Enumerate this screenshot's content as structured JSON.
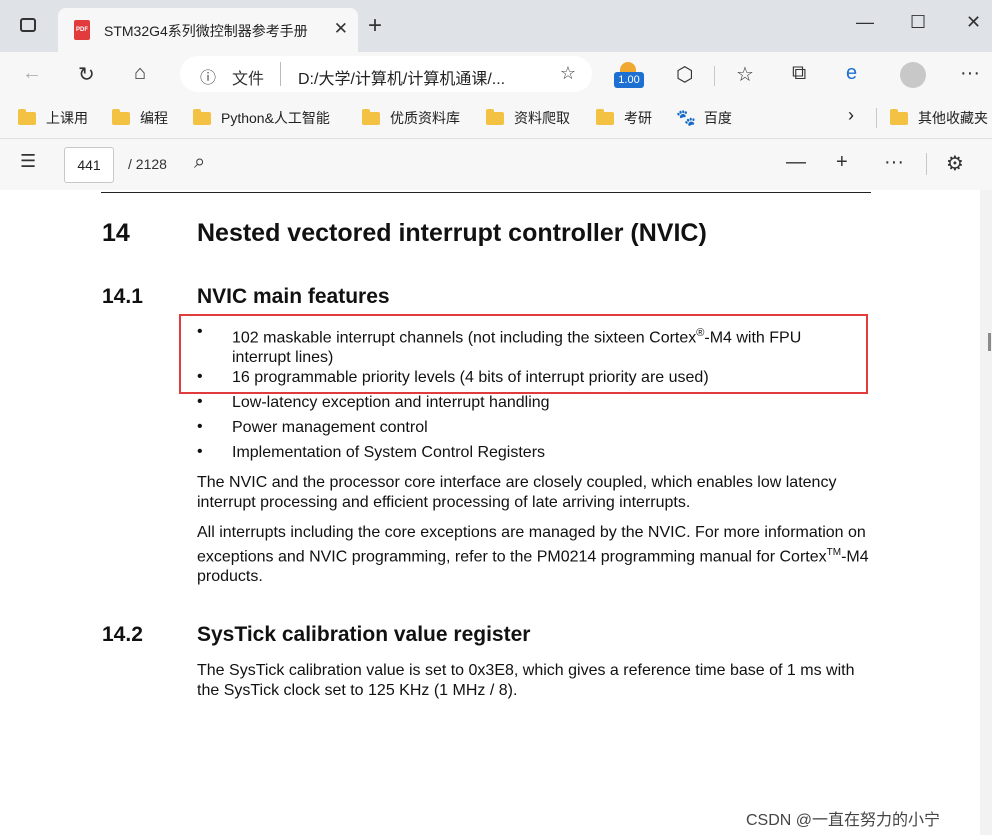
{
  "browser": {
    "tab": {
      "icon_label": "PDF",
      "title": "STM32G4系列微控制器参考手册",
      "close": "✕"
    },
    "new_tab": "+",
    "window_controls": {
      "minimize": "—",
      "maximize": "☐",
      "close": "✕"
    },
    "address": {
      "protocol_label": "文件",
      "path": "D:/大学/计算机/计算机通课/..."
    },
    "extension_badge": "1.00",
    "bookmarks": [
      {
        "label": "上课用",
        "icon": "folder-icon"
      },
      {
        "label": "编程",
        "icon": "folder-icon"
      },
      {
        "label": "Python&人工智能",
        "icon": "folder-icon"
      },
      {
        "label": "优质资料库",
        "icon": "folder-icon"
      },
      {
        "label": "资料爬取",
        "icon": "folder-icon"
      },
      {
        "label": "考研",
        "icon": "folder-icon"
      },
      {
        "label": "百度",
        "icon": "baidu-paw-icon"
      }
    ],
    "other_bookmarks": "其他收藏夹"
  },
  "pdf_toolbar": {
    "page_current": "441",
    "page_total": "/ 2128"
  },
  "document": {
    "chapter_num": "14",
    "chapter_title": "Nested vectored interrupt controller (NVIC)",
    "section1_num": "14.1",
    "section1_title": "NVIC main features",
    "features": [
      {
        "pre": "102 maskable interrupt channels (not including the sixteen Cortex",
        "sup": "®",
        "post": "-M4 with FPU interrupt lines)"
      },
      {
        "text": "16 programmable priority levels (4 bits of interrupt priority are used)"
      },
      {
        "text": "Low-latency exception and interrupt handling"
      },
      {
        "text": "Power management control"
      },
      {
        "text": "Implementation of System Control Registers"
      }
    ],
    "para1": "The NVIC and the processor core interface are closely coupled, which enables low latency interrupt processing and efficient processing of late arriving interrupts.",
    "para2_pre": "All interrupts including the core exceptions are managed by the NVIC. For more information on exceptions and NVIC programming, refer to the PM0214 programming manual for Cortex",
    "para2_sup": "TM",
    "para2_post": "-M4 products.",
    "section2_num": "14.2",
    "section2_title": "SysTick calibration value register",
    "para3": "The SysTick calibration value is set to 0x3E8, which gives a reference time base of 1 ms with the SysTick clock set to 125 KHz (1 MHz / 8)."
  },
  "watermark": "CSDN @一直在努力的小宁",
  "colors": {
    "highlight_box": "#e13b3b",
    "titlebar": "#dfe3e8",
    "toolbar": "#f7f7f7"
  }
}
